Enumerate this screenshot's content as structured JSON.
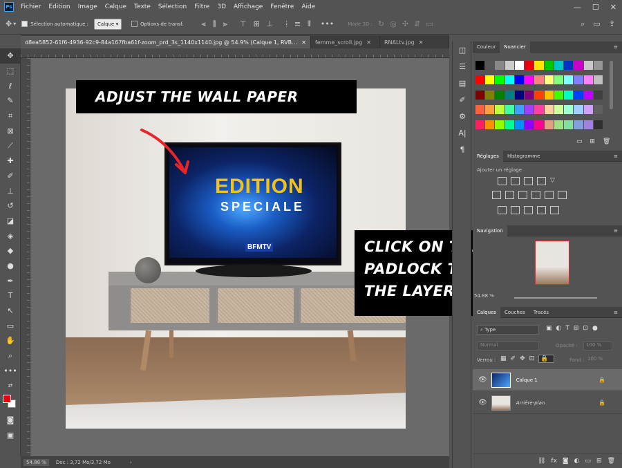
{
  "app": {
    "logo": "Ps"
  },
  "menubar": {
    "items": [
      "Fichier",
      "Edition",
      "Image",
      "Calque",
      "Texte",
      "Sélection",
      "Filtre",
      "3D",
      "Affichage",
      "Fenêtre",
      "Aide"
    ]
  },
  "options": {
    "auto_select_label": "Sélection automatique :",
    "auto_select_target": "Calque",
    "transform_controls_label": "Options de transf.",
    "mode3d_label": "Mode 3D :"
  },
  "tabs": [
    {
      "label": "d8ea5852-61f6-4936-92c9-84a167fba61f-zoom_prd_3s_1140x1140.jpg @ 54.9% (Calque 1, RVB/8) *",
      "active": true
    },
    {
      "label": "femme_scroll.jpg",
      "active": false
    },
    {
      "label": "RNALtv.jpg",
      "active": false
    }
  ],
  "status": {
    "zoom": "54.88 %",
    "doc": "Doc : 3,72 Mo/3,72 Mo"
  },
  "annotations": {
    "wallpaper": "ADJUST THE WALL PAPER",
    "padlock_line1": "CLICK ON THE",
    "padlock_line2": "PADLOCK TO LOCK",
    "padlock_line3": "THE LAYER",
    "arrow_color": "#e8262a"
  },
  "tv": {
    "title": "EDITION",
    "subtitle": "SPECIALE",
    "channel": "BFMTV"
  },
  "swatches_panel": {
    "tabs": [
      "Couleur",
      "Nuancier"
    ]
  },
  "adjust_panel": {
    "tabs": [
      "Réglages",
      "Histogramme"
    ],
    "title": "Ajouter un réglage"
  },
  "navigator_panel": {
    "tab": "Navigation",
    "zoom": "54.88 %"
  },
  "layers_panel": {
    "tabs": [
      "Calques",
      "Couches",
      "Tracés"
    ],
    "filter": "Type",
    "blend_mode": "Normal",
    "opacity_label": "Opacité :",
    "opacity_value": "100 %",
    "lock_label": "Verrou :",
    "fill_label": "Fond :",
    "fill_value": "100 %",
    "layers": [
      {
        "name": "Calque 1",
        "locked": true,
        "selected": true
      },
      {
        "name": "Arrière-plan",
        "locked": true,
        "selected": false
      }
    ]
  },
  "colors": {
    "accent": "#31a8ff",
    "annotation_bg": "#000000",
    "foreground": "#e8000d",
    "background_color": "#ffffff"
  }
}
